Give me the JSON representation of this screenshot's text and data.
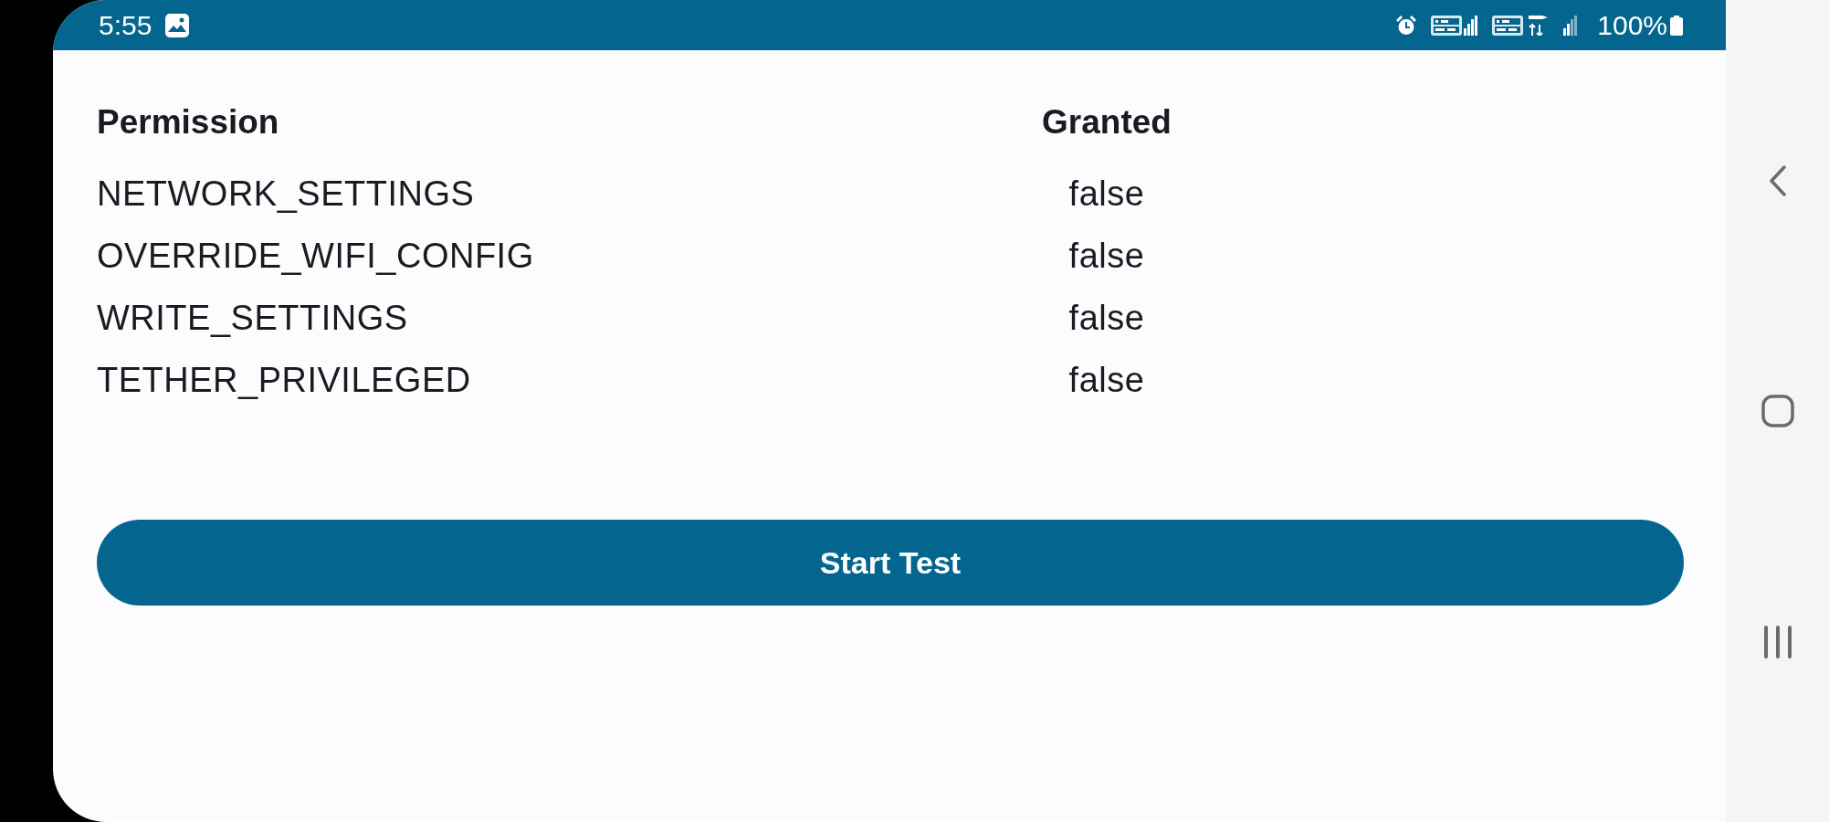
{
  "status_bar": {
    "time": "5:55",
    "battery": "100%"
  },
  "table": {
    "columns": [
      "Permission",
      "Granted"
    ],
    "rows": [
      {
        "permission": "NETWORK_SETTINGS",
        "granted": "false"
      },
      {
        "permission": "OVERRIDE_WIFI_CONFIG",
        "granted": "false"
      },
      {
        "permission": "WRITE_SETTINGS",
        "granted": "false"
      },
      {
        "permission": "TETHER_PRIVILEGED",
        "granted": "false"
      }
    ]
  },
  "button": {
    "label": "Start Test"
  }
}
